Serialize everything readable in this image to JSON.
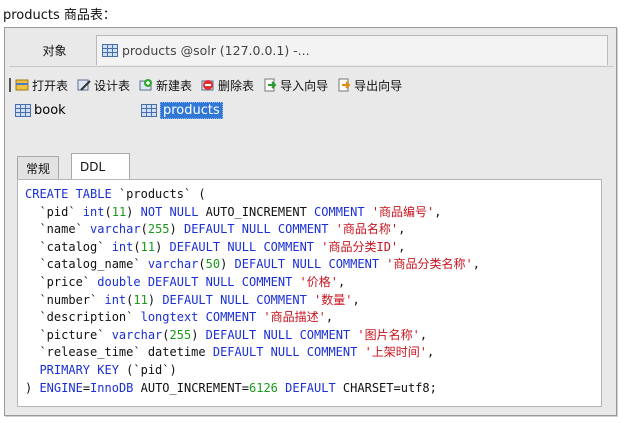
{
  "caption": "products 商品表：",
  "window": {
    "tabs": {
      "object_tab": "对象",
      "products_tab": "products @solr (127.0.0.1) -..."
    },
    "toolbar": {
      "open": "打开表",
      "design": "设计表",
      "new": "新建表",
      "delete": "删除表",
      "import": "导入向导",
      "export": "导出向导"
    },
    "objects": [
      "book",
      "products"
    ],
    "selected_object": "products",
    "panel_tabs": [
      "常规",
      "DDL"
    ],
    "active_panel_tab": "DDL",
    "ddl_lines": [
      [
        {
          "t": "kw",
          "v": "CREATE TABLE "
        },
        {
          "t": "plain",
          "v": "`products` ("
        }
      ],
      [
        {
          "t": "plain",
          "v": "  `pid` "
        },
        {
          "t": "kw",
          "v": "int"
        },
        {
          "t": "plain",
          "v": "("
        },
        {
          "t": "num",
          "v": "11"
        },
        {
          "t": "plain",
          "v": ") "
        },
        {
          "t": "kw",
          "v": "NOT NULL "
        },
        {
          "t": "plain",
          "v": "AUTO_INCREMENT "
        },
        {
          "t": "kw",
          "v": "COMMENT "
        },
        {
          "t": "str",
          "v": "'商品编号'"
        },
        {
          "t": "plain",
          "v": ","
        }
      ],
      [
        {
          "t": "plain",
          "v": "  `name` "
        },
        {
          "t": "kw",
          "v": "varchar"
        },
        {
          "t": "plain",
          "v": "("
        },
        {
          "t": "num",
          "v": "255"
        },
        {
          "t": "plain",
          "v": ") "
        },
        {
          "t": "kw",
          "v": "DEFAULT NULL COMMENT "
        },
        {
          "t": "str",
          "v": "'商品名称'"
        },
        {
          "t": "plain",
          "v": ","
        }
      ],
      [
        {
          "t": "plain",
          "v": "  `catalog` "
        },
        {
          "t": "kw",
          "v": "int"
        },
        {
          "t": "plain",
          "v": "("
        },
        {
          "t": "num",
          "v": "11"
        },
        {
          "t": "plain",
          "v": ") "
        },
        {
          "t": "kw",
          "v": "DEFAULT NULL COMMENT "
        },
        {
          "t": "str",
          "v": "'商品分类ID'"
        },
        {
          "t": "plain",
          "v": ","
        }
      ],
      [
        {
          "t": "plain",
          "v": "  `catalog_name` "
        },
        {
          "t": "kw",
          "v": "varchar"
        },
        {
          "t": "plain",
          "v": "("
        },
        {
          "t": "num",
          "v": "50"
        },
        {
          "t": "plain",
          "v": ") "
        },
        {
          "t": "kw",
          "v": "DEFAULT NULL COMMENT "
        },
        {
          "t": "str",
          "v": "'商品分类名称'"
        },
        {
          "t": "plain",
          "v": ","
        }
      ],
      [
        {
          "t": "plain",
          "v": "  `price` "
        },
        {
          "t": "kw",
          "v": "double DEFAULT NULL COMMENT "
        },
        {
          "t": "str",
          "v": "'价格'"
        },
        {
          "t": "plain",
          "v": ","
        }
      ],
      [
        {
          "t": "plain",
          "v": "  `number` "
        },
        {
          "t": "kw",
          "v": "int"
        },
        {
          "t": "plain",
          "v": "("
        },
        {
          "t": "num",
          "v": "11"
        },
        {
          "t": "plain",
          "v": ") "
        },
        {
          "t": "kw",
          "v": "DEFAULT NULL COMMENT "
        },
        {
          "t": "str",
          "v": "'数量'"
        },
        {
          "t": "plain",
          "v": ","
        }
      ],
      [
        {
          "t": "plain",
          "v": "  `description` "
        },
        {
          "t": "kw",
          "v": "longtext COMMENT "
        },
        {
          "t": "str",
          "v": "'商品描述'"
        },
        {
          "t": "plain",
          "v": ","
        }
      ],
      [
        {
          "t": "plain",
          "v": "  `picture` "
        },
        {
          "t": "kw",
          "v": "varchar"
        },
        {
          "t": "plain",
          "v": "("
        },
        {
          "t": "num",
          "v": "255"
        },
        {
          "t": "plain",
          "v": ") "
        },
        {
          "t": "kw",
          "v": "DEFAULT NULL COMMENT "
        },
        {
          "t": "str",
          "v": "'图片名称'"
        },
        {
          "t": "plain",
          "v": ","
        }
      ],
      [
        {
          "t": "plain",
          "v": "  `release_time` datetime "
        },
        {
          "t": "kw",
          "v": "DEFAULT NULL COMMENT "
        },
        {
          "t": "str",
          "v": "'上架时间'"
        },
        {
          "t": "plain",
          "v": ","
        }
      ],
      [
        {
          "t": "plain",
          "v": "  "
        },
        {
          "t": "kw",
          "v": "PRIMARY KEY "
        },
        {
          "t": "plain",
          "v": "(`pid`)"
        }
      ],
      [
        {
          "t": "plain",
          "v": ") "
        },
        {
          "t": "kw",
          "v": "ENGINE"
        },
        {
          "t": "plain",
          "v": "="
        },
        {
          "t": "kw",
          "v": "InnoDB "
        },
        {
          "t": "plain",
          "v": "AUTO_INCREMENT="
        },
        {
          "t": "num",
          "v": "6126 "
        },
        {
          "t": "kw",
          "v": "DEFAULT "
        },
        {
          "t": "plain",
          "v": "CHARSET=utf8;"
        }
      ]
    ]
  }
}
